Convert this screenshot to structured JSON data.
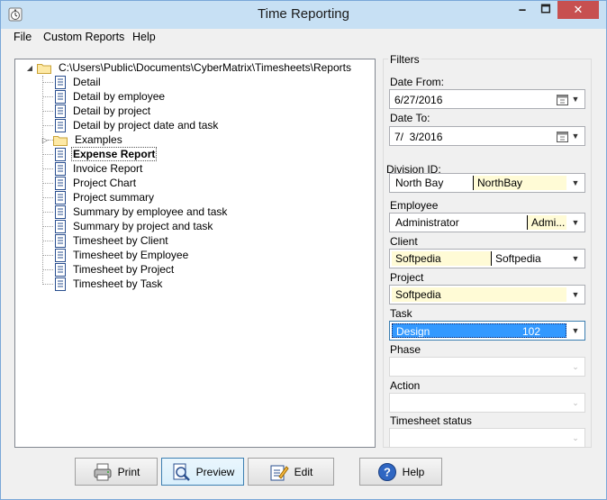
{
  "window": {
    "title": "Time Reporting"
  },
  "window_controls": {
    "minimize": "🗕",
    "maximize": "🗖",
    "close": "✕"
  },
  "menu": [
    "File",
    "Custom Reports",
    "Help"
  ],
  "tree": {
    "root_path": "C:\\Users\\Public\\Documents\\CyberMatrix\\Timesheets\\Reports",
    "items": [
      "Detail",
      "Detail by employee",
      "Detail by project",
      "Detail by project date and task",
      "Examples",
      "Expense Report",
      "Invoice Report",
      "Project Chart",
      "Project summary",
      "Summary by employee and task",
      "Summary by project and task",
      "Timesheet by Client",
      "Timesheet by Employee",
      "Timesheet by Project",
      "Timesheet by Task"
    ],
    "selected": "Expense Report"
  },
  "filters": {
    "title": "Filters",
    "date_from_label": "Date From:",
    "date_from": "6/27/2016",
    "date_to_label": "Date To:",
    "date_to": "7/  3/2016",
    "division_label": "Division ID:",
    "division_col1": "North Bay",
    "division_col2": "NorthBay",
    "employee_label": "Employee",
    "employee_col1": "Administrator",
    "employee_col2": "Admi...",
    "client_label": "Client",
    "client_col1": "Softpedia",
    "client_col2": "Softpedia",
    "project_label": "Project",
    "project_col1": "Softpedia",
    "task_label": "Task",
    "task_col1": "Design",
    "task_col2": "102",
    "phase_label": "Phase",
    "action_label": "Action",
    "timesheet_status_label": "Timesheet status"
  },
  "buttons": {
    "print": "Print",
    "preview": "Preview",
    "edit": "Edit",
    "help": "Help"
  },
  "colors": {
    "titlebar": "#c7e0f4",
    "close": "#c75050",
    "selection": "#3399ff",
    "highlight_cell": "#fffbd6"
  }
}
